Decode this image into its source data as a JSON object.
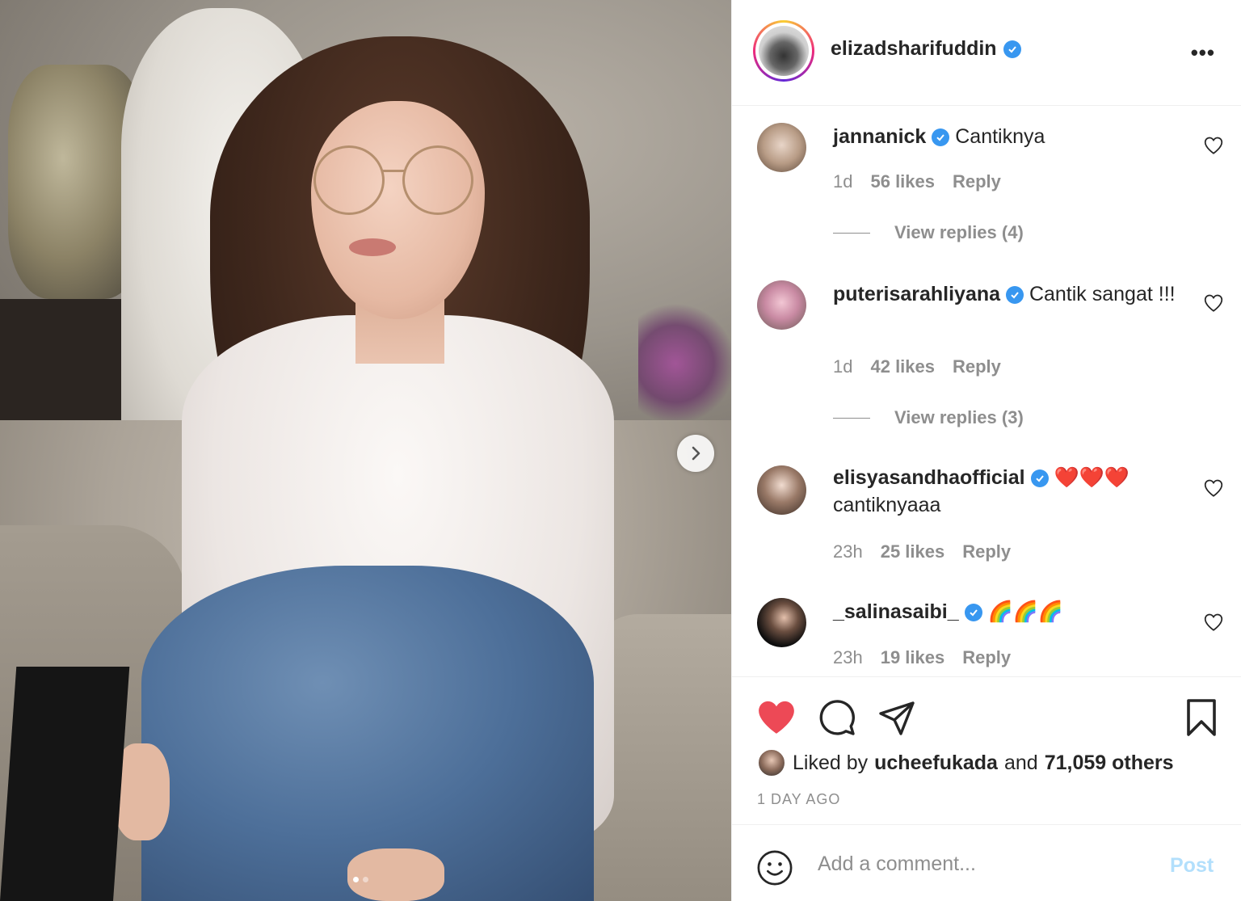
{
  "post": {
    "owner": "elizadsharifuddin",
    "carousel": {
      "total": 2,
      "current": 1
    }
  },
  "comments": [
    {
      "username": "jannanick",
      "text": "Cantiknya",
      "time": "1d",
      "likes": "56 likes",
      "reply": "Reply",
      "view_replies": "View replies (4)"
    },
    {
      "username": "puterisarahliyana",
      "text": "Cantik sangat !!!",
      "time": "1d",
      "likes": "42 likes",
      "reply": "Reply",
      "view_replies": "View replies (3)"
    },
    {
      "username": "elisyasandhaofficial",
      "text": "❤️❤️❤️ cantiknyaaa",
      "time": "23h",
      "likes": "25 likes",
      "reply": "Reply"
    },
    {
      "username": "_salinasaibi_",
      "text": "🌈🌈🌈",
      "time": "23h",
      "likes": "19 likes",
      "reply": "Reply"
    }
  ],
  "likes": {
    "prefix": "Liked by",
    "user": "uchee​fukada",
    "conj": "and",
    "others": "71,059 others"
  },
  "posted_ago": "1 DAY AGO",
  "add_comment": {
    "placeholder": "Add a comment...",
    "post_label": "Post"
  },
  "colors": {
    "accent": "#3897f0",
    "like_red": "#ed4956",
    "post_disabled": "#b2dffc",
    "muted": "#8e8e8e"
  },
  "icons": [
    "more-options-icon",
    "verified-badge-icon",
    "heart-icon",
    "comment-icon",
    "share-icon",
    "bookmark-icon",
    "emoji-icon",
    "chevron-right-icon"
  ]
}
